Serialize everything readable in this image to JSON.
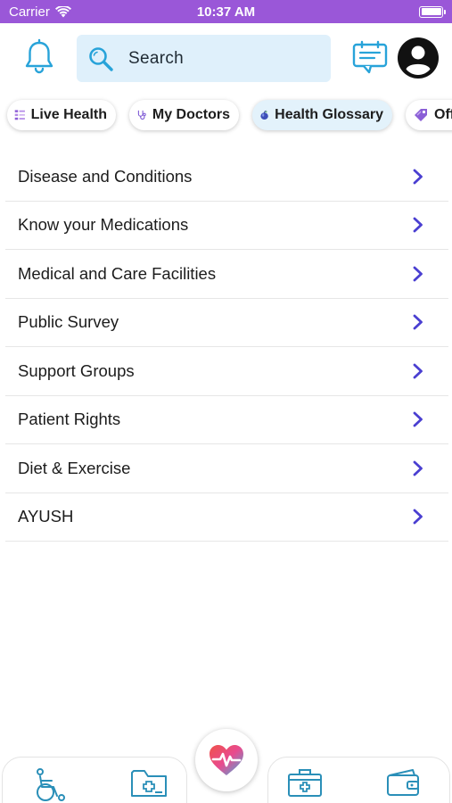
{
  "status_bar": {
    "carrier": "Carrier",
    "time": "10:37 AM"
  },
  "header": {
    "search_label": "Search"
  },
  "chips": [
    {
      "label": "Live Health",
      "icon": "list-icon"
    },
    {
      "label": "My Doctors",
      "icon": "stethoscope-icon"
    },
    {
      "label": "Health Glossary",
      "icon": "apple-icon",
      "active": true
    },
    {
      "label": "Off",
      "icon": "tag-icon"
    }
  ],
  "menu_items": [
    {
      "label": "Disease and Conditions"
    },
    {
      "label": "Know your Medications"
    },
    {
      "label": "Medical and Care Facilities"
    },
    {
      "label": "Public Survey"
    },
    {
      "label": "Support Groups"
    },
    {
      "label": "Patient Rights"
    },
    {
      "label": "Diet & Exercise"
    },
    {
      "label": "AYUSH"
    }
  ],
  "tab_bar": {
    "icons": [
      "wheelchair-icon",
      "medical-folder-icon",
      "heart-pulse-icon",
      "first-aid-kit-icon",
      "wallet-icon"
    ]
  },
  "colors": {
    "status_bar": "#9a57d8",
    "accent_blue": "#28a3d9",
    "chevron": "#4a3fd1",
    "search_bg": "#dff0fb"
  }
}
